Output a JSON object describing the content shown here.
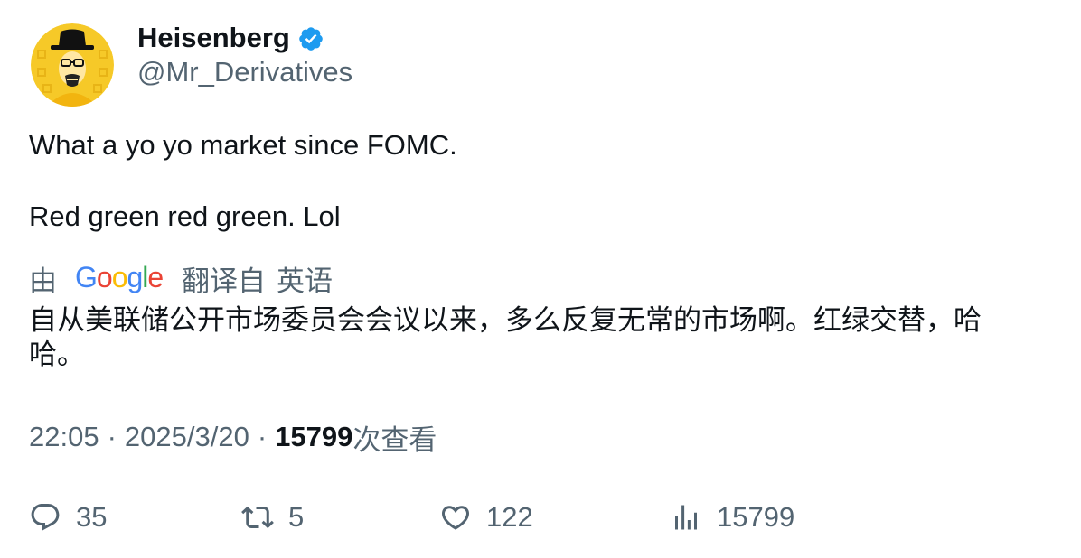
{
  "author": {
    "display_name": "Heisenberg",
    "handle": "@Mr_Derivatives",
    "verified": true,
    "avatar_icon": "heisenberg-avatar",
    "verified_icon": "verified-badge-icon",
    "verified_color": "#1d9bf0"
  },
  "tweet": {
    "lines": [
      "What a yo yo market since FOMC.",
      "Red green red green. Lol"
    ]
  },
  "translation": {
    "by_label": "由",
    "provider": "Google",
    "from_label": "翻译自",
    "language": "英语",
    "text": "自从美联储公开市场委员会会议以来，多么反复无常的市场啊。红绿交替，哈哈。"
  },
  "meta": {
    "time": "22:05",
    "separator": "·",
    "date": "2025/3/20",
    "views_count": "15799",
    "views_label": "次查看"
  },
  "actions": {
    "replies": {
      "icon": "reply-icon",
      "count": "35"
    },
    "retweets": {
      "icon": "retweet-icon",
      "count": "5"
    },
    "likes": {
      "icon": "heart-icon",
      "count": "122"
    },
    "views": {
      "icon": "views-icon",
      "count": "15799"
    }
  },
  "colors": {
    "text_primary": "#0f1419",
    "text_secondary": "#536471",
    "avatar_background": "#f6c928"
  }
}
